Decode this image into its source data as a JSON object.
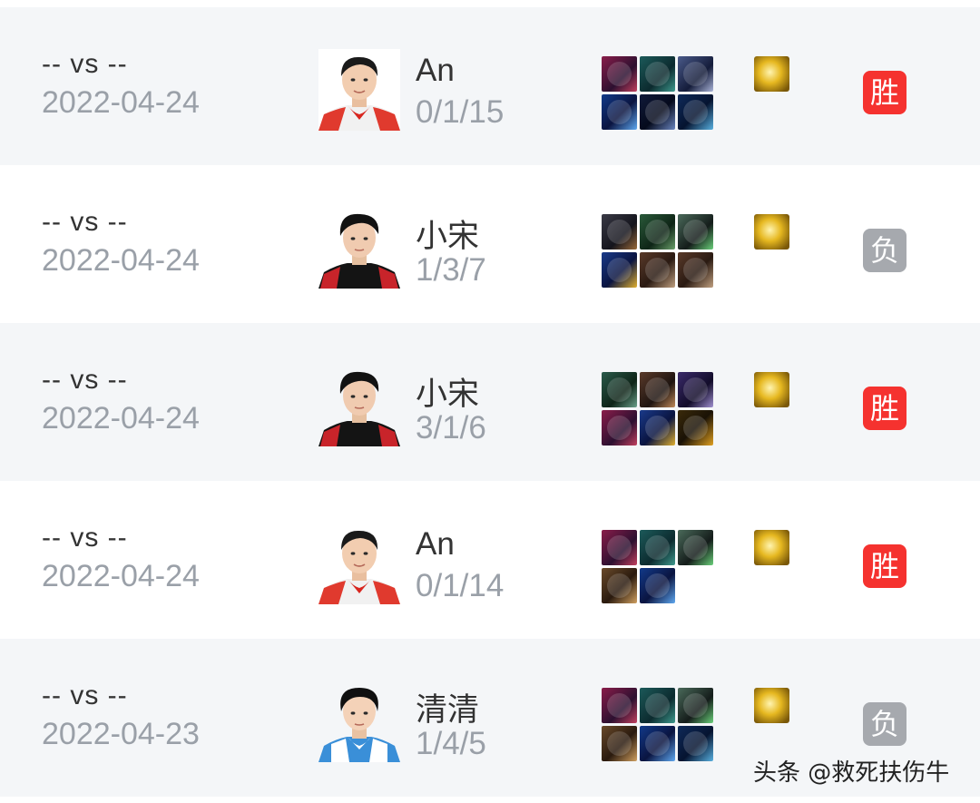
{
  "colors": {
    "win_badge": "#f5322f",
    "loss_badge": "#a6a9ae",
    "row_alt_bg": "#f4f6f8",
    "secondary_text": "#9aa0a8"
  },
  "matches": [
    {
      "opponents": "-- vs --",
      "date": "2022-04-24",
      "player": "An",
      "kda": "0/1/15",
      "result": "胜",
      "result_type": "win",
      "avatar_jersey": "red-white",
      "items": [
        "pink-armor",
        "teal-boots",
        "silver-helm",
        "blue-blade",
        "dark-blade",
        "cyan-blade"
      ],
      "rune": "gold-rune"
    },
    {
      "opponents": "-- vs --",
      "date": "2022-04-24",
      "player": "小宋",
      "kda": "1/3/7",
      "result": "负",
      "result_type": "loss",
      "avatar_jersey": "black-red",
      "items": [
        "dark-armor",
        "green-boots",
        "green-helm",
        "gold-blade",
        "brown-mask",
        "brown-mask"
      ],
      "rune": "gold-rune"
    },
    {
      "opponents": "-- vs --",
      "date": "2022-04-24",
      "player": "小宋",
      "kda": "3/1/6",
      "result": "胜",
      "result_type": "win",
      "avatar_jersey": "black-red",
      "items": [
        "green-boots",
        "bronze-armor",
        "purple-helm",
        "pink-armor",
        "gold-blade",
        "gold-crescent"
      ],
      "rune": "gold-rune"
    },
    {
      "opponents": "-- vs --",
      "date": "2022-04-24",
      "player": "An",
      "kda": "0/1/14",
      "result": "胜",
      "result_type": "win",
      "avatar_jersey": "red-white",
      "items": [
        "pink-armor",
        "teal-boots",
        "green-helm",
        "bronze-shield",
        "blue-blade"
      ],
      "rune": "gold-rune"
    },
    {
      "opponents": "-- vs --",
      "date": "2022-04-23",
      "player": "清清",
      "kda": "1/4/5",
      "result": "负",
      "result_type": "loss",
      "avatar_jersey": "blue-white",
      "items": [
        "pink-armor",
        "teal-boots",
        "green-helm",
        "bronze-shield",
        "blue-blade",
        "cyan-blade"
      ],
      "rune": "gold-rune"
    }
  ],
  "watermark": "头条 @救死扶伤牛"
}
